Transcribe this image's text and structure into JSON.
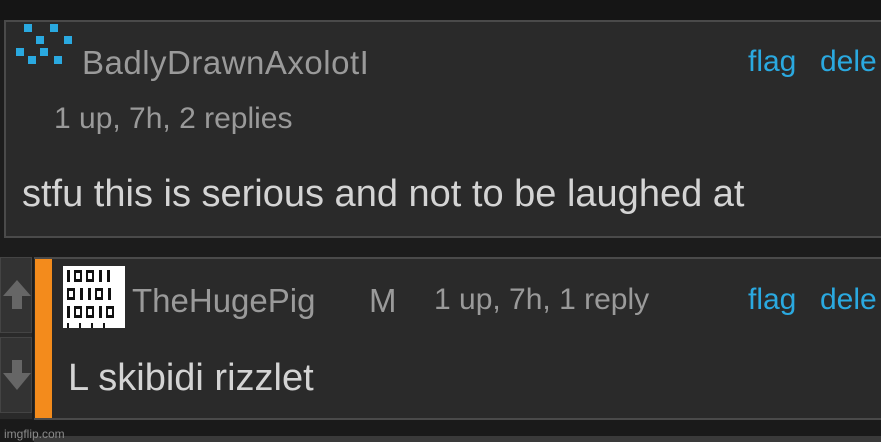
{
  "comments": [
    {
      "username": "BadlyDrawnAxolotI",
      "meta": "1 up, 7h, 2 replies",
      "text": "stfu this is serious and not to be laughed at",
      "actions": {
        "flag": "flag",
        "delete": "dele"
      },
      "avatar_icon": "pixel-pattern-icon",
      "avatar_color": "#2aa9e0"
    },
    {
      "username": "TheHugePig",
      "badge": "M",
      "meta": "1 up, 7h, 1 reply",
      "text": "L skibidi rizzlet",
      "actions": {
        "flag": "flag",
        "delete": "dele"
      },
      "avatar_icon": "binary-code-icon",
      "accent_color": "#f38b1c"
    }
  ],
  "vote": {
    "up_icon": "arrow-up-icon",
    "down_icon": "arrow-down-icon"
  },
  "watermark": "imgflip.com",
  "colors": {
    "background": "#2a2a2a",
    "link": "#2aa9e0",
    "muted_text": "#9a9a9a",
    "body_text": "#d4d4d4",
    "accent": "#f38b1c"
  }
}
